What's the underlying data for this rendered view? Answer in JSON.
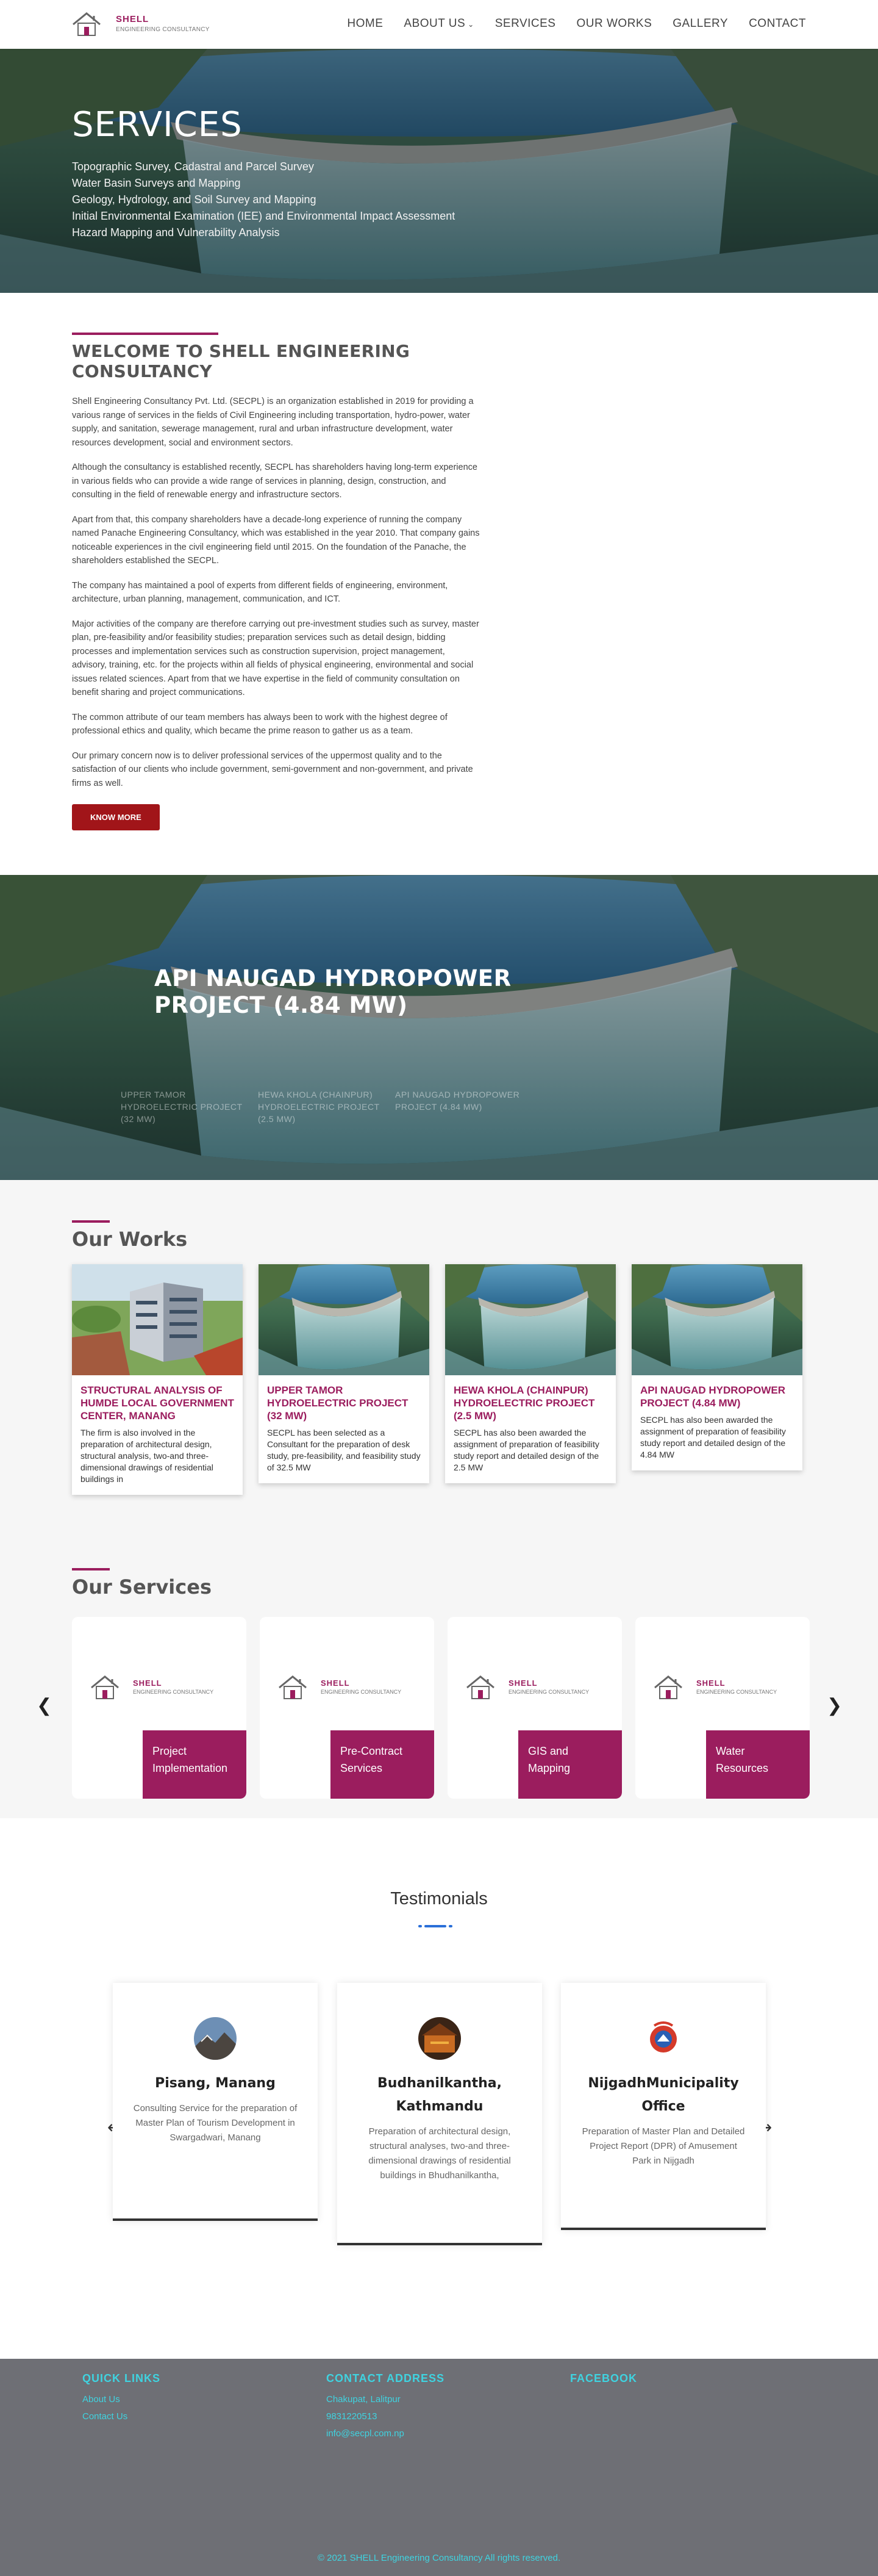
{
  "header": {
    "logo_title": "SHELL",
    "logo_subtitle": "ENGINEERING CONSULTANCY",
    "nav": [
      "HOME",
      "ABOUT US",
      "SERVICES",
      "OUR WORKS",
      "GALLERY",
      "CONTACT"
    ]
  },
  "hero": {
    "title": "SERVICES",
    "items": [
      "Topographic Survey, Cadastral and Parcel Survey",
      "Water Basin Surveys and Mapping",
      "Geology, Hydrology, and Soil Survey and Mapping",
      "Initial Environmental Examination (IEE) and Environmental Impact Assessment",
      "Hazard Mapping and Vulnerability Analysis"
    ]
  },
  "welcome": {
    "title": "WELCOME TO SHELL ENGINEERING CONSULTANCY",
    "paragraphs": [
      "Shell Engineering Consultancy Pvt. Ltd. (SECPL) is an organization established in 2019 for providing a various range of services in the fields of Civil Engineering including transportation, hydro-power, water supply, and sanitation, sewerage management, rural and urban infrastructure development, water resources development, social and environment sectors.",
      "Although the consultancy is established recently, SECPL has shareholders having long-term experience in various fields who can provide a wide range of services in planning, design, construction, and consulting in the field of renewable energy and infrastructure sectors.",
      "Apart from that, this company shareholders have a decade-long experience of running the company named Panache Engineering Consultancy, which was established in the year 2010. That company gains noticeable experiences in the civil engineering field until 2015. On the foundation of the Panache, the shareholders established the SECPL.",
      "The company has maintained a pool of experts from different fields of engineering, environment, architecture, urban planning, management, communication, and ICT.",
      "Major activities of the company are therefore carrying out pre-investment studies such as survey, master plan, pre-feasibility and/or feasibility studies; preparation services such as detail design, bidding processes and implementation services such as construction supervision, project management, advisory, training, etc. for the projects within all fields of physical engineering, environmental and social issues related sciences. Apart from that we have expertise in the field of community consultation on benefit sharing and project communications.",
      "The common attribute of our team members has always been to work with the highest degree of professional ethics and quality, which became the prime reason to gather us as a team.",
      "Our primary concern now is to deliver professional services of the uppermost quality and to the satisfaction of our clients who include government, semi-government and non-government, and private firms as well."
    ],
    "button": "KNOW MORE"
  },
  "slider": {
    "title": "API NAUGAD HYDROPOWER PROJECT (4.84 MW)",
    "thumbs": [
      "UPPER TAMOR HYDROELECTRIC PROJECT (32 MW)",
      "HEWA KHOLA (CHAINPUR) HYDROELECTRIC PROJECT (2.5 MW)",
      "API NAUGAD HYDROPOWER PROJECT (4.84 MW)"
    ]
  },
  "works": {
    "title": "Our Works",
    "cards": [
      {
        "title": "STRUCTURAL ANALYSIS OF HUMDE LOCAL GOVERNMENT CENTER, MANANG",
        "text": "The firm is also involved in the preparation of architectural design, structural analysis, two-and three-dimensional drawings of residential buildings in"
      },
      {
        "title": "UPPER TAMOR HYDROELECTRIC PROJECT (32 MW)",
        "text": "SECPL has been selected as a Consultant for the preparation of desk study, pre-feasibility, and feasibility study of 32.5 MW"
      },
      {
        "title": "HEWA KHOLA (CHAINPUR) HYDROELECTRIC PROJECT (2.5 MW)",
        "text": "SECPL has also been awarded the assignment of preparation of feasibility study report and detailed design of the 2.5 MW"
      },
      {
        "title": "API NAUGAD HYDROPOWER PROJECT (4.84 MW)",
        "text": "SECPL has also been awarded the assignment of preparation of feasibility study report and detailed design of the 4.84 MW"
      }
    ]
  },
  "services": {
    "title": "Our Services",
    "items": [
      "Project Implementation",
      "Pre-Contract Services",
      "GIS and Mapping",
      "Water Resources"
    ]
  },
  "testimonials": {
    "title": "Testimonials",
    "items": [
      {
        "name": "Pisang, Manang",
        "text": "Consulting Service for the preparation of Master Plan of Tourism Development in Swargadwari, Manang"
      },
      {
        "name": "Budhanilkantha, Kathmandu",
        "text": "Preparation of architectural design, structural analyses, two-and three-dimensional drawings of residential buildings in Bhudhanilkantha,"
      },
      {
        "name": "NijgadhMunicipality Office",
        "text": "Preparation of Master Plan and Detailed Project Report (DPR) of Amusement Park in Nijgadh"
      }
    ]
  },
  "footer": {
    "quick_links_title": "QUICK LINKS",
    "quick_links": [
      "About Us",
      "Contact Us"
    ],
    "contact_title": "CONTACT ADDRESS",
    "contact": [
      "Chakupat, Lalitpur",
      "9831220513",
      "info@secpl.com.np"
    ],
    "facebook_title": "FACEBOOK",
    "copyright": "© 2021 SHELL Engineering Consultancy All rights reserved."
  },
  "colors": {
    "brand": "#9b1d5e",
    "button": "#a11519",
    "footer_bg": "#6e6f75",
    "footer_text": "#3fd3e0"
  }
}
